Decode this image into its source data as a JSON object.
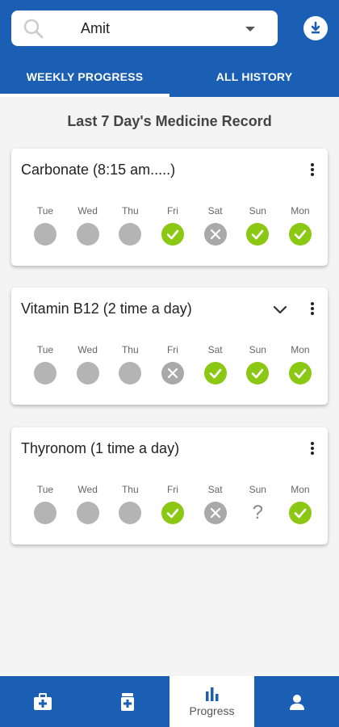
{
  "search": {
    "value": "Amit"
  },
  "tabs": [
    {
      "label": "WEEKLY PROGRESS",
      "active": true
    },
    {
      "label": "ALL HISTORY",
      "active": false
    }
  ],
  "section_title": "Last 7 Day's Medicine Record",
  "colors": {
    "primary": "#1a5fb4",
    "taken": "#8bc814",
    "missed": "#a9a9a9",
    "none": "#b4b4b4"
  },
  "medicines": [
    {
      "title": "Carbonate (8:15 am.....)",
      "has_chevron": false,
      "days": [
        {
          "label": "Tue",
          "status": "none"
        },
        {
          "label": "Wed",
          "status": "none"
        },
        {
          "label": "Thu",
          "status": "none"
        },
        {
          "label": "Fri",
          "status": "taken"
        },
        {
          "label": "Sat",
          "status": "missed"
        },
        {
          "label": "Sun",
          "status": "taken"
        },
        {
          "label": "Mon",
          "status": "taken"
        }
      ]
    },
    {
      "title": "Vitamin B12 (2 time a day)",
      "has_chevron": true,
      "days": [
        {
          "label": "Tue",
          "status": "none"
        },
        {
          "label": "Wed",
          "status": "none"
        },
        {
          "label": "Thu",
          "status": "none"
        },
        {
          "label": "Fri",
          "status": "missed"
        },
        {
          "label": "Sat",
          "status": "taken"
        },
        {
          "label": "Sun",
          "status": "taken"
        },
        {
          "label": "Mon",
          "status": "taken"
        }
      ]
    },
    {
      "title": "Thyronom (1 time a day)",
      "has_chevron": false,
      "days": [
        {
          "label": "Tue",
          "status": "none"
        },
        {
          "label": "Wed",
          "status": "none"
        },
        {
          "label": "Thu",
          "status": "none"
        },
        {
          "label": "Fri",
          "status": "taken"
        },
        {
          "label": "Sat",
          "status": "missed"
        },
        {
          "label": "Sun",
          "status": "unknown",
          "symbol": "?"
        },
        {
          "label": "Mon",
          "status": "taken"
        }
      ]
    }
  ],
  "bottom_nav": [
    {
      "icon": "medical-kit-icon",
      "label": "",
      "active": false
    },
    {
      "icon": "medicine-bottle-icon",
      "label": "",
      "active": false
    },
    {
      "icon": "bar-chart-icon",
      "label": "Progress",
      "active": true
    },
    {
      "icon": "person-icon",
      "label": "",
      "active": false
    }
  ]
}
